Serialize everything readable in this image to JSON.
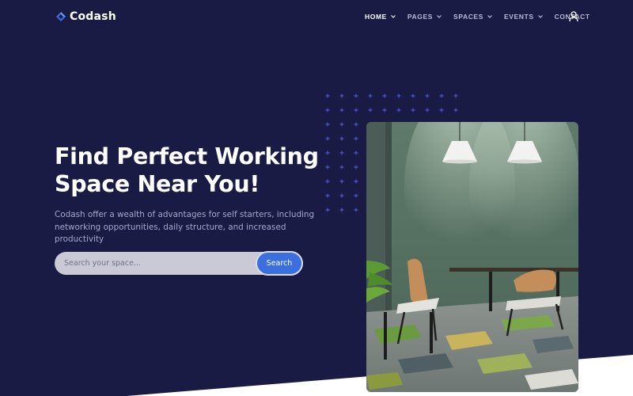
{
  "brand": {
    "name": "Codash",
    "logo_icon": "diamond-logo-icon"
  },
  "nav": {
    "items": [
      {
        "label": "HOME",
        "active": true,
        "has_dropdown": true
      },
      {
        "label": "PAGES",
        "active": false,
        "has_dropdown": true
      },
      {
        "label": "SPACES",
        "active": false,
        "has_dropdown": true
      },
      {
        "label": "EVENTS",
        "active": false,
        "has_dropdown": true
      },
      {
        "label": "CONTACT",
        "active": false,
        "has_dropdown": false
      }
    ],
    "user_icon": "user-icon"
  },
  "hero": {
    "title_line1": "Find Perfect Working",
    "title_line2": "Space Near You!",
    "description": "Codash offer a wealth of advantages for self starters, including networking opportunities, daily structure, and increased productivity",
    "search": {
      "placeholder": "Search your space...",
      "button_label": "Search"
    },
    "image": "office-workspace-photo"
  },
  "colors": {
    "background": "#1a1b45",
    "accent": "#3b6fe0",
    "dot_pattern": "#4a56c9",
    "nav_text": "#b8bad6"
  }
}
